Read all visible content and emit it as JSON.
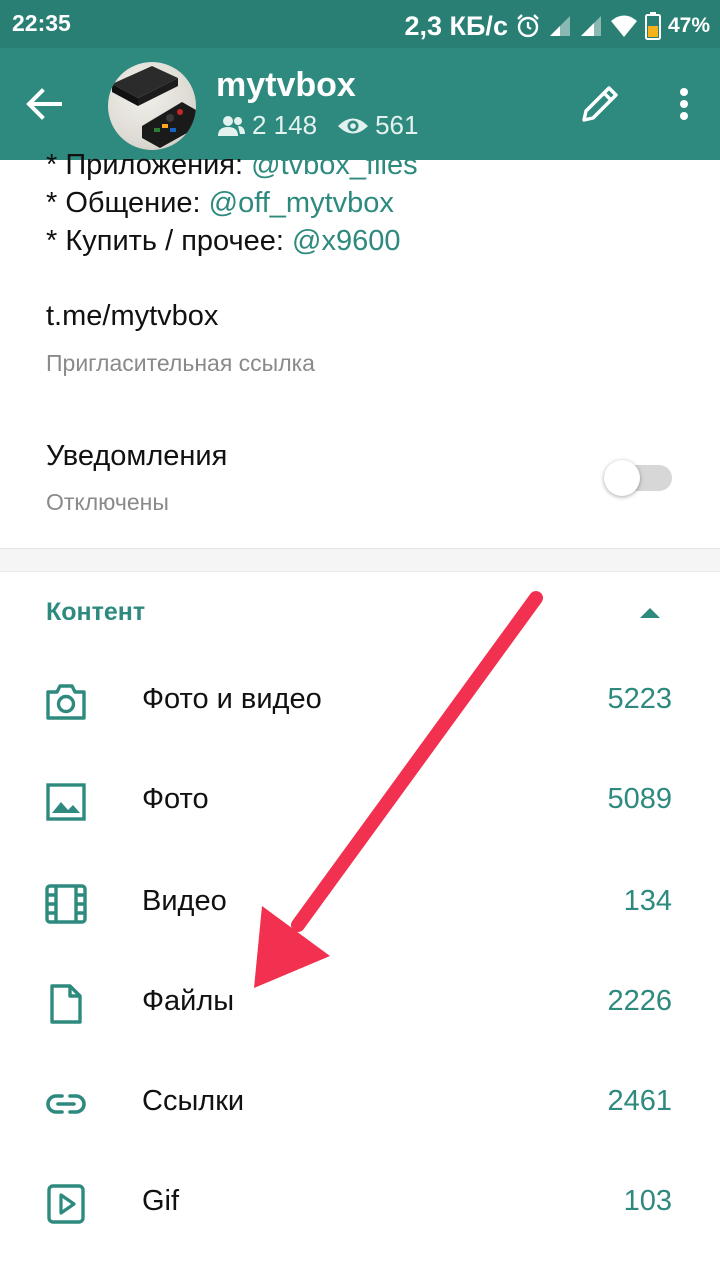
{
  "status_bar": {
    "time": "22:35",
    "speed": "2,3 КБ/с",
    "battery": "47%",
    "icons": [
      "alarm-icon",
      "signal-icon",
      "signal-icon",
      "wifi-icon",
      "battery-icon"
    ]
  },
  "header": {
    "title": "mytvbox",
    "subscribers": "2 148",
    "views": "561",
    "icons": [
      "back-arrow-icon",
      "people-icon",
      "eye-icon",
      "pencil-icon",
      "more-vert-icon"
    ]
  },
  "description": {
    "lines": [
      {
        "prefix": "* Приложения: ",
        "link": "@tvbox_files"
      },
      {
        "prefix": "* Общение: ",
        "link": "@off_mytvbox"
      },
      {
        "prefix": "* Купить / прочее: ",
        "link": "@x9600"
      }
    ]
  },
  "invite": {
    "link": "t.me/mytvbox",
    "caption": "Пригласительная ссылка"
  },
  "notifications": {
    "title": "Уведомления",
    "caption": "Отключены",
    "enabled": false
  },
  "content_section": {
    "title": "Контент",
    "items": [
      {
        "label": "Фото и видео",
        "count": "5223",
        "icon": "camera-icon"
      },
      {
        "label": "Фото",
        "count": "5089",
        "icon": "image-icon"
      },
      {
        "label": "Видео",
        "count": "134",
        "icon": "film-icon"
      },
      {
        "label": "Файлы",
        "count": "2226",
        "icon": "file-icon"
      },
      {
        "label": "Ссылки",
        "count": "2461",
        "icon": "link-icon"
      },
      {
        "label": "Gif",
        "count": "103",
        "icon": "gif-icon"
      }
    ]
  },
  "colors": {
    "status_bar": "#2a7f75",
    "header": "#2e8a7e",
    "accent": "#2e8a7e",
    "arrow": "#f2304f"
  }
}
